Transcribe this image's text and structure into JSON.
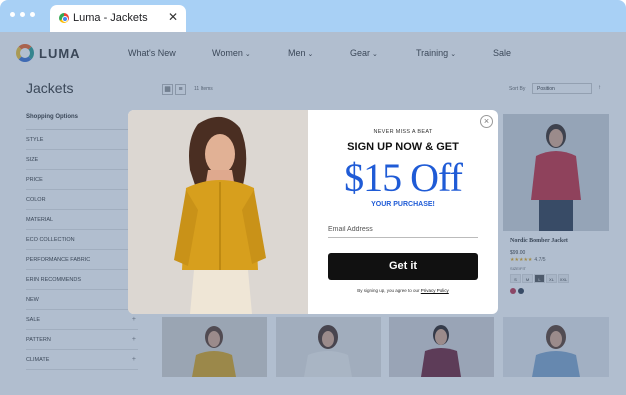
{
  "browser": {
    "tab_title": "Luma - Jackets",
    "tab_close": "✕"
  },
  "header": {
    "logo_text": "LUMA",
    "nav": [
      {
        "label": "What's New",
        "has_menu": false
      },
      {
        "label": "Women",
        "has_menu": true
      },
      {
        "label": "Men",
        "has_menu": true
      },
      {
        "label": "Gear",
        "has_menu": true
      },
      {
        "label": "Training",
        "has_menu": true
      },
      {
        "label": "Sale",
        "has_menu": false
      }
    ]
  },
  "category": {
    "title": "Jackets",
    "items_count": "11 Items",
    "sort_label": "Sort By",
    "sort_value": "Position"
  },
  "sidebar": {
    "heading": "Shopping Options",
    "filters": [
      {
        "label": "STYLE",
        "expand": ""
      },
      {
        "label": "SIZE",
        "expand": ""
      },
      {
        "label": "PRICE",
        "expand": ""
      },
      {
        "label": "COLOR",
        "expand": ""
      },
      {
        "label": "MATERIAL",
        "expand": ""
      },
      {
        "label": "ECO COLLECTION",
        "expand": ""
      },
      {
        "label": "PERFORMANCE FABRIC",
        "expand": ""
      },
      {
        "label": "ERIN RECOMMENDS",
        "expand": ""
      },
      {
        "label": "NEW",
        "expand": ""
      },
      {
        "label": "SALE",
        "expand": "+"
      },
      {
        "label": "PATTERN",
        "expand": "+"
      },
      {
        "label": "CLIMATE",
        "expand": "+"
      }
    ]
  },
  "featured_product": {
    "name": "Nordic Bomber Jacket",
    "price": "$99.00",
    "stars": "★★★★★",
    "rating": "4.7/5",
    "sizes_label": "SIZE/FIT",
    "sizes": [
      "S",
      "M",
      "L",
      "XL",
      "XXL"
    ],
    "selected_size": "L",
    "swatches": [
      "#c0334a",
      "#2f3a4a"
    ]
  },
  "popup": {
    "eyebrow": "NEVER MISS A BEAT",
    "headline": "SIGN UP NOW & GET",
    "offer": "$15 Off",
    "subline": "YOUR PURCHASE!",
    "email_placeholder": "Email Address",
    "cta_label": "Get it",
    "disclaimer_prefix": "By signing up, you agree to our",
    "privacy_link": "Privacy Policy",
    "close_label": "×"
  },
  "colors": {
    "accent_blue": "#1f5bd6",
    "cta_black": "#111111",
    "overlay": "#46648c",
    "browser_chrome": "#a8d0f5"
  }
}
